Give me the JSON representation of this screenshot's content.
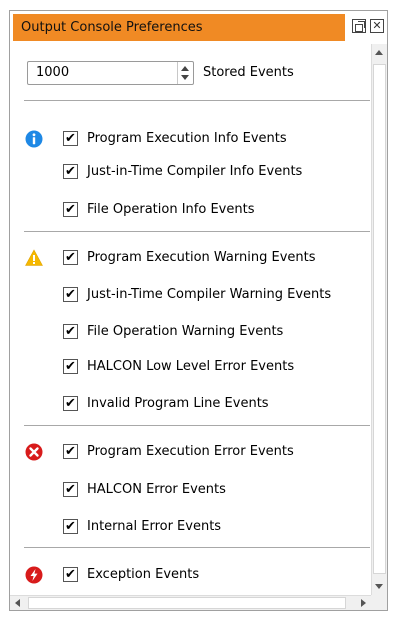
{
  "window": {
    "title": "Output Console Preferences",
    "accent_color": "#f08a24",
    "float_icon": "float-window-icon",
    "close_icon": "close-icon",
    "close_glyph": "✕"
  },
  "stored_events": {
    "value": "1000",
    "label": "Stored Events"
  },
  "check_glyph": "✔",
  "groups": [
    {
      "severity": "info",
      "icon": "info-icon",
      "icon_glyph": "i",
      "color": "#1e88e5",
      "items": [
        {
          "label": "Program Execution Info Events",
          "checked": true
        },
        {
          "label": "Just-in-Time Compiler Info Events",
          "checked": true
        },
        {
          "label": "File Operation Info Events",
          "checked": true
        }
      ]
    },
    {
      "severity": "warning",
      "icon": "warning-icon",
      "icon_glyph": "!",
      "color": "#f5b800",
      "items": [
        {
          "label": "Program Execution Warning Events",
          "checked": true
        },
        {
          "label": "Just-in-Time Compiler Warning Events",
          "checked": true
        },
        {
          "label": "File Operation Warning Events",
          "checked": true
        },
        {
          "label": "HALCON Low Level Error Events",
          "checked": true
        },
        {
          "label": "Invalid Program Line Events",
          "checked": true
        }
      ]
    },
    {
      "severity": "error",
      "icon": "error-icon",
      "icon_glyph": "✕",
      "color": "#d81b1b",
      "items": [
        {
          "label": "Program Execution Error Events",
          "checked": true
        },
        {
          "label": "HALCON Error Events",
          "checked": true
        },
        {
          "label": "Internal Error Events",
          "checked": true
        }
      ]
    },
    {
      "severity": "exception",
      "icon": "exception-icon",
      "icon_glyph": "ϟ",
      "color": "#d81b1b",
      "items": [
        {
          "label": "Exception Events",
          "checked": true
        }
      ]
    }
  ]
}
